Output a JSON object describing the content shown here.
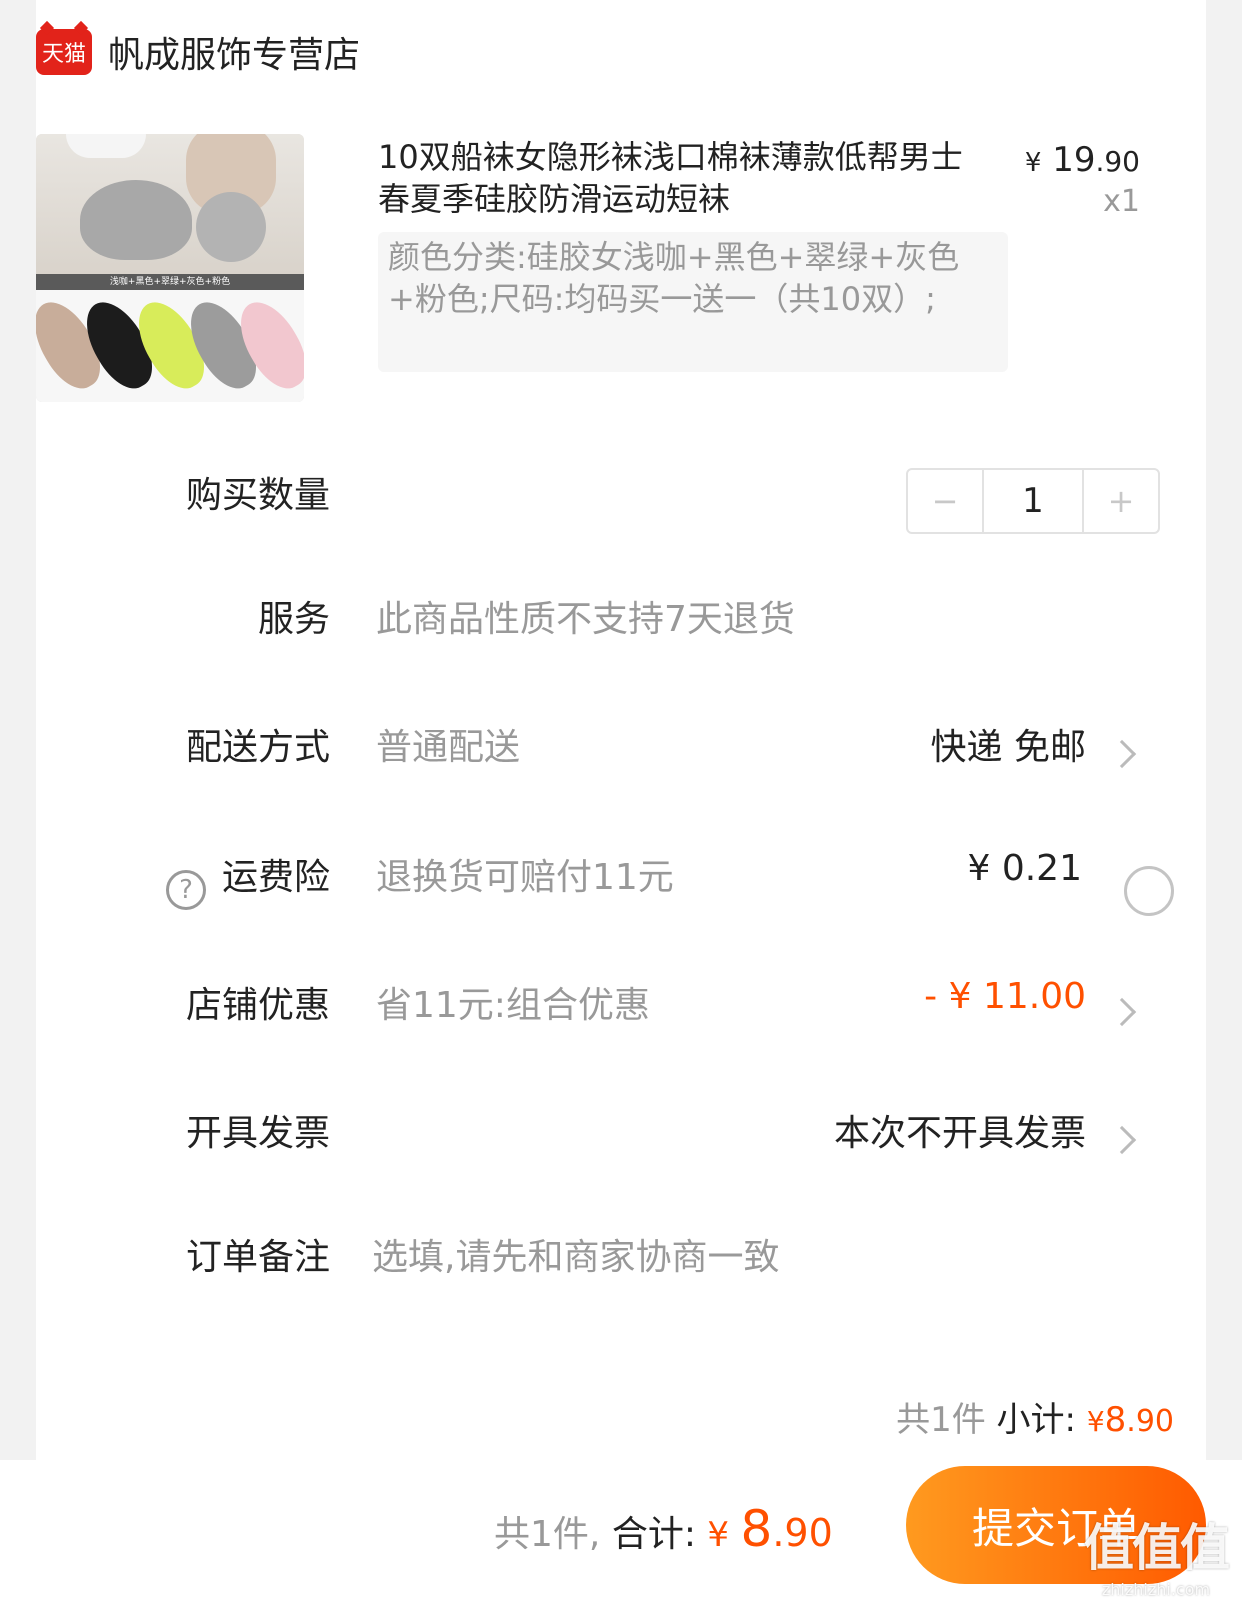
{
  "store": {
    "logo_text": "天猫",
    "name": "帆成服饰专营店"
  },
  "product": {
    "image_caption": "浅咖+黑色+翠绿+灰色+粉色",
    "title": "10双船袜女隐形袜浅口棉袜薄款低帮男士春夏季硅胶防滑运动短袜",
    "price_yen": "¥",
    "price_int": "19",
    "price_cents": ".90",
    "quantity": "x1",
    "sku": "颜色分类:硅胶女浅咖+黑色+翠绿+灰色+粉色;尺码:均码买一送一（共10双）;"
  },
  "rows": {
    "quantity": {
      "label": "购买数量",
      "minus": "−",
      "value": "1",
      "plus": "+"
    },
    "service": {
      "label": "服务",
      "desc": "此商品性质不支持7天退货"
    },
    "delivery": {
      "label": "配送方式",
      "desc": "普通配送",
      "value": "快递 免邮"
    },
    "insurance": {
      "label": "运费险",
      "desc": "退换货可赔付11元",
      "value": "¥ 0.21"
    },
    "discount": {
      "label": "店铺优惠",
      "desc": "省11元:组合优惠",
      "value": "- ¥ 11.00"
    },
    "invoice": {
      "label": "开具发票",
      "value": "本次不开具发票"
    },
    "note": {
      "label": "订单备注",
      "placeholder": "选填,请先和商家协商一致"
    }
  },
  "subtotal": {
    "count": "共1件",
    "label": "小计:",
    "yen": "¥",
    "int": "8",
    "cents": ".90"
  },
  "footer": {
    "count": "共1件,",
    "label": "合计:",
    "yen": "¥",
    "int": "8",
    "cents": ".90",
    "submit": "提交订单"
  },
  "watermark": {
    "main": "值值值",
    "url": "zhizhizhi.com"
  },
  "colors": {
    "accent": "#ff5000",
    "brand_red": "#e2231a",
    "button_start": "#ff9a1f",
    "button_end": "#ff5a00"
  },
  "icons": {
    "help": "question-circle-icon",
    "chevron": "chevron-right-icon",
    "radio": "radio-unchecked-icon"
  },
  "sock_colors": [
    "#c8ad9a",
    "#1c1c1c",
    "#d8ec5a",
    "#9c9c9c",
    "#f2c7cf"
  ]
}
